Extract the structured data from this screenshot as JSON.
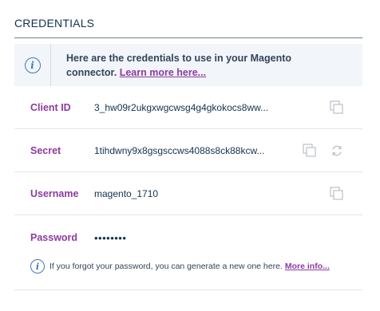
{
  "section": {
    "title": "CREDENTIALS"
  },
  "notice": {
    "icon": "info-icon",
    "text": "Here are the credentials to use in your Magento connector.",
    "link_label": "Learn more here..."
  },
  "credentials": {
    "client_id": {
      "label": "Client ID",
      "value": "3_hw09r2ukgxwgcwsg4g4gkokocs8ww..."
    },
    "secret": {
      "label": "Secret",
      "value": "1tihdwny9x8gsgsccws4088s8ck88kcw..."
    },
    "username": {
      "label": "Username",
      "value": "magento_1710"
    },
    "password": {
      "label": "Password",
      "value": "••••••••"
    }
  },
  "hint": {
    "text": "If you forgot your password, you can generate a new one here.",
    "link_label": "More info..."
  },
  "colors": {
    "accent_purple": "#8e3aa1",
    "info_blue": "#3f78b8",
    "text_dark": "#11324d",
    "notice_bg": "#f2f5fa",
    "icon_gray": "#b9c0c7"
  }
}
